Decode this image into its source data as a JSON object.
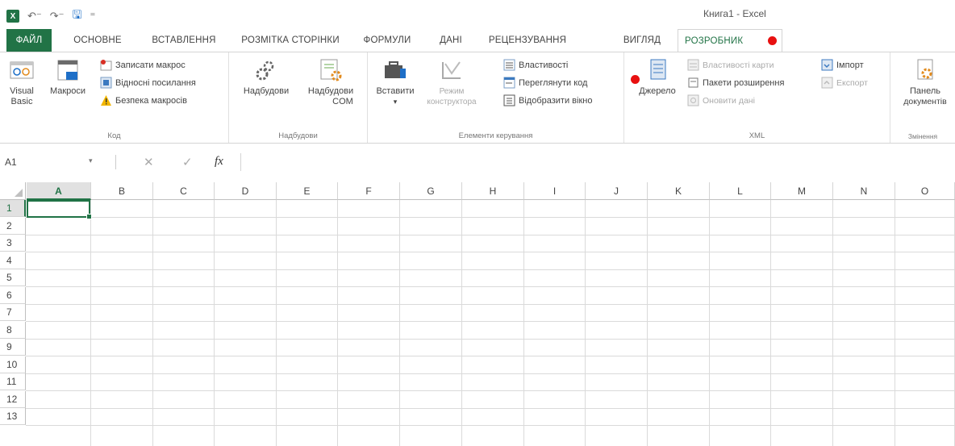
{
  "app": {
    "window_title": "Книга1 - Excel"
  },
  "qat": {
    "logo": "X"
  },
  "tabs": [
    {
      "label": "ФАЙЛ"
    },
    {
      "label": "ОСНОВНЕ"
    },
    {
      "label": "ВСТАВЛЕННЯ"
    },
    {
      "label": "РОЗМІТКА СТОРІНКИ"
    },
    {
      "label": "ФОРМУЛИ"
    },
    {
      "label": "ДАНІ"
    },
    {
      "label": "РЕЦЕНЗУВАННЯ"
    },
    {
      "label": "ВИГЛЯД"
    },
    {
      "label": "РОЗРОБНИК"
    }
  ],
  "ribbon": {
    "code": {
      "label": "Код",
      "visual_basic": [
        "Visual",
        "Basic"
      ],
      "macros": "Макроси",
      "record_macro": "Записати макрос",
      "relative_refs": "Відносні посилання",
      "macro_security": "Безпека макросів"
    },
    "addins": {
      "label": "Надбудови",
      "addins": "Надбудови",
      "com_addins": [
        "Надбудови",
        "COM"
      ]
    },
    "controls": {
      "label": "Елементи керування",
      "insert": "Вставити",
      "design_mode": [
        "Режим",
        "конструктора"
      ],
      "properties": "Властивості",
      "view_code": "Переглянути код",
      "show_window": "Відобразити вікно"
    },
    "xml": {
      "label": "XML",
      "source": "Джерело",
      "map_properties": "Властивості карти",
      "expansion_packs": "Пакети розширення",
      "refresh_data": "Оновити дані",
      "import": "Імпорт",
      "export": "Експорт"
    },
    "modify": {
      "label": "Змінення",
      "doc_panel": [
        "Панель",
        "документів"
      ]
    }
  },
  "formula_bar": {
    "name_box": "A1",
    "fx": "fx",
    "cancel": "✕",
    "enter": "✓",
    "value": ""
  },
  "grid": {
    "columns": [
      "A",
      "B",
      "C",
      "D",
      "E",
      "F",
      "G",
      "H",
      "I",
      "J",
      "K",
      "L",
      "M",
      "N",
      "O"
    ],
    "rows": [
      "1",
      "2",
      "3",
      "4",
      "5",
      "6",
      "7",
      "8",
      "9",
      "10",
      "11",
      "12",
      "13"
    ],
    "selected_cell": "A1"
  },
  "colors": {
    "excel_green": "#217346",
    "marker_red": "#e81010"
  }
}
